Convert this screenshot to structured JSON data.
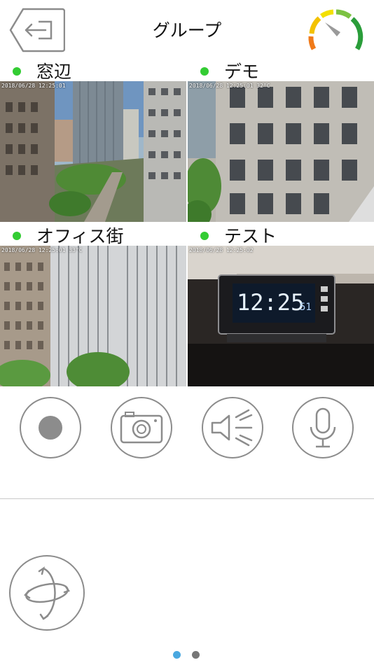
{
  "header": {
    "title": "グループ",
    "back_icon": "exit-arrow-icon",
    "status_icon": "signal-gauge-icon"
  },
  "cameras": [
    {
      "name": "窓辺",
      "timestamp": "2018/06/28 12:25:01",
      "status": "online",
      "selected": true
    },
    {
      "name": "デモ",
      "timestamp": "2018/06/28 12:25:01 32°C",
      "status": "online",
      "selected": false
    },
    {
      "name": "オフィス街",
      "timestamp": "2018/06/28 12:25:01 33°C",
      "status": "online",
      "selected": false
    },
    {
      "name": "テスト",
      "timestamp": "2018/06/28 12:25:02",
      "status": "online",
      "selected": false
    }
  ],
  "colors": {
    "online": "#33cc33",
    "selected_border": "#d9292b",
    "icon_gray": "#8c8c8c",
    "pager_active": "#4aa8e0",
    "pager_inactive": "#777777"
  },
  "controls": [
    "record-icon",
    "camera-icon",
    "speaker-icon",
    "microphone-icon"
  ],
  "ptz_icon": "ptz-rotate-icon",
  "pager": {
    "pages": 2,
    "current": 1
  }
}
